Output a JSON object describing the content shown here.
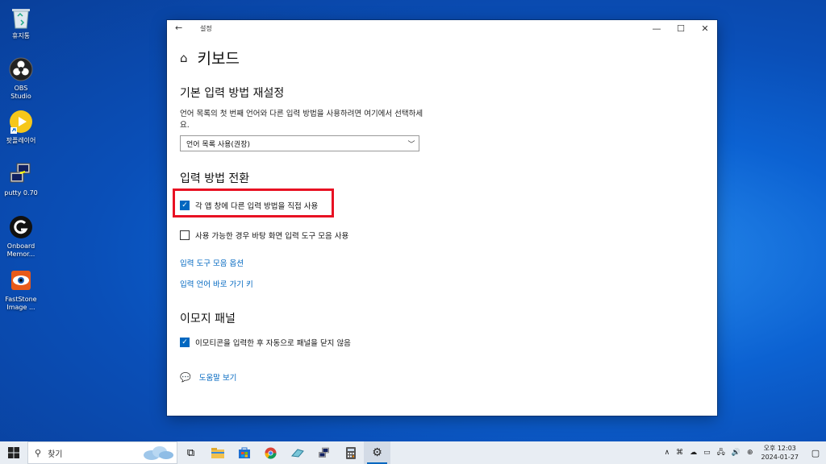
{
  "desktop": {
    "icons": [
      {
        "label": "휴지통",
        "icon": "recycle-bin-icon"
      },
      {
        "label": "OBS Studio",
        "icon": "obs-icon"
      },
      {
        "label": "팟플레이어",
        "icon": "potplayer-icon"
      },
      {
        "label": "putty 0.70",
        "icon": "putty-icon"
      },
      {
        "label": "Onboard Memor...",
        "icon": "logitech-icon"
      },
      {
        "label": "FastStone Image ...",
        "icon": "faststone-icon"
      }
    ]
  },
  "window": {
    "title": "설정",
    "back": "←",
    "minimize": "—",
    "maximize": "☐",
    "close": "✕"
  },
  "page": {
    "title": "키보드",
    "sections": {
      "default_input": {
        "heading": "기본 입력 방법 재설정",
        "description": "언어 목록의 첫 번째 언어와 다른 입력 방법을 사용하려면 여기에서 선택하세요.",
        "dropdown_value": "언어 목록 사용(권장)"
      },
      "switching": {
        "heading": "입력 방법 전환",
        "checkbox1": {
          "label": "각 앱 창에 다른 입력 방법을 직접 사용",
          "checked": true
        },
        "checkbox2": {
          "label": "사용 가능한 경우 바탕 화면 입력 도구 모음 사용",
          "checked": false
        },
        "link1": "입력 도구 모음 옵션",
        "link2": "입력 언어 바로 가기 키"
      },
      "emoji": {
        "heading": "이모지 패널",
        "checkbox": {
          "label": "이모티콘을 입력한 후 자동으로 패널을 닫지 않음",
          "checked": true
        }
      }
    },
    "help": "도움말 보기"
  },
  "taskbar": {
    "search_placeholder": "찾기",
    "apps": [
      "task-view-icon",
      "file-explorer-icon",
      "store-icon",
      "chrome-icon",
      "app-icon",
      "putty-icon",
      "calculator-icon",
      "settings-icon"
    ],
    "clock": {
      "ampm_time": "오후 12:03",
      "date": "2024-01-27"
    }
  },
  "colors": {
    "accent": "#0067c0",
    "highlight": "#e81123"
  }
}
